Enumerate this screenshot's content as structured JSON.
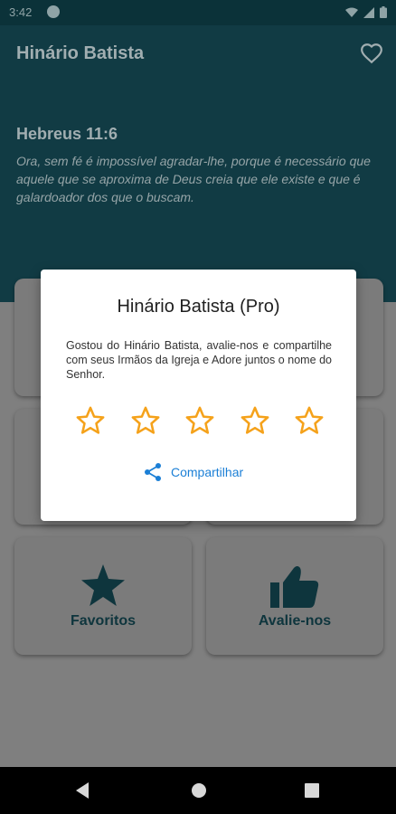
{
  "status_bar": {
    "time": "3:42"
  },
  "header": {
    "title": "Hinário Batista",
    "verse_ref": "Hebreus 11:6",
    "verse_text": "Ora, sem fé é impossível agradar-lhe, porque é necessário que aquele que se aproxima de Deus creia que ele existe e que é galardoador dos que o buscam."
  },
  "cards": {
    "favorites_label": "Favoritos",
    "rate_label": "Avalie-nos"
  },
  "dialog": {
    "title": "Hinário Batista (Pro)",
    "message": "Gostou do Hinário Batista, avalie-nos e compartilhe com seus Irmãos da Igreja e Adore juntos o nome do Senhor.",
    "rating": {
      "stars_total": 5,
      "selected": 0
    },
    "share_label": "Compartilhar"
  },
  "colors": {
    "header_bg": "#113b44",
    "star": "#f5a21b",
    "share": "#1b7fd6",
    "icon": "#0e353d"
  }
}
